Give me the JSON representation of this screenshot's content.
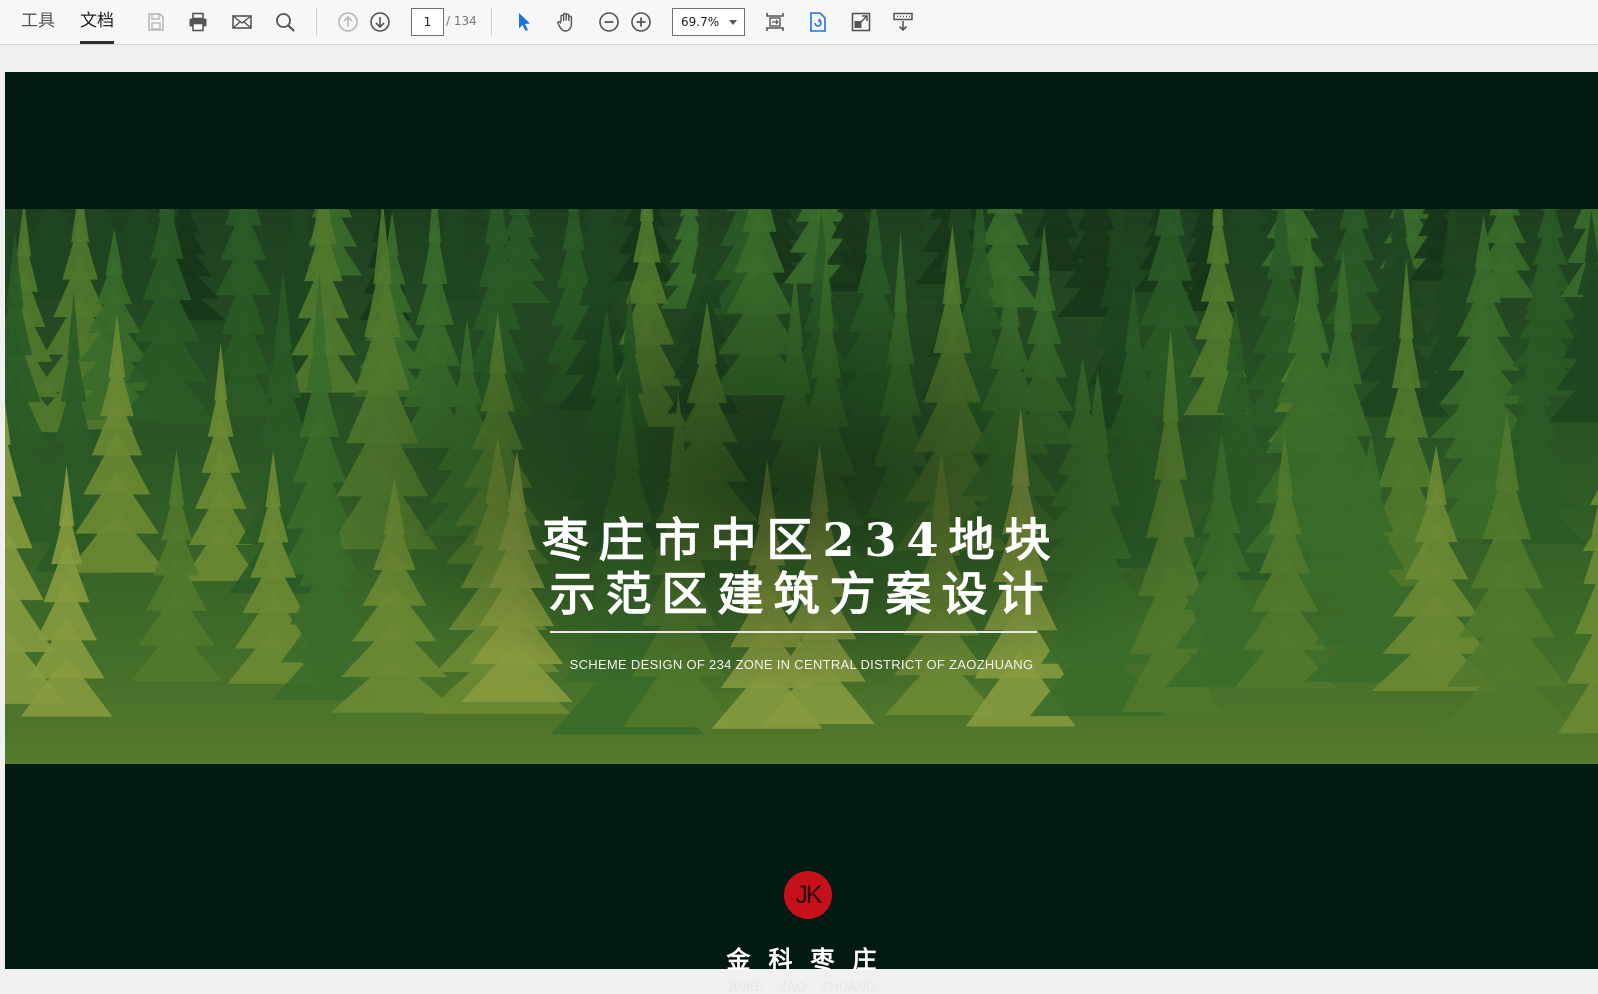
{
  "toolbar": {
    "tab_tools": "工具",
    "tab_document": "文档",
    "current_page": "1",
    "total_pages": "/ 134",
    "zoom": "69.7%",
    "icons": [
      "save-icon",
      "print-icon",
      "mail-icon",
      "search-icon",
      "page-up-icon",
      "page-down-icon",
      "select-pointer-icon",
      "hand-tool-icon",
      "zoom-out-icon",
      "zoom-in-icon",
      "fit-page-icon",
      "rotate-icon",
      "full-screen-icon",
      "read-mode-icon"
    ],
    "accent_color": "#1a73e8"
  },
  "document": {
    "title_line1": "枣庄市中区234地块",
    "title_line2": "示范区建筑方案设计",
    "subtitle": "SCHEME DESIGN OF 234 ZONE IN CENTRAL DISTRICT OF ZAOZHUANG",
    "logo_text": "JK",
    "brand_cn": "金科枣庄",
    "brand_en": "JINKE ZAO ZHUANG",
    "background_color": "#031a13",
    "logo_color": "#c6111b"
  }
}
